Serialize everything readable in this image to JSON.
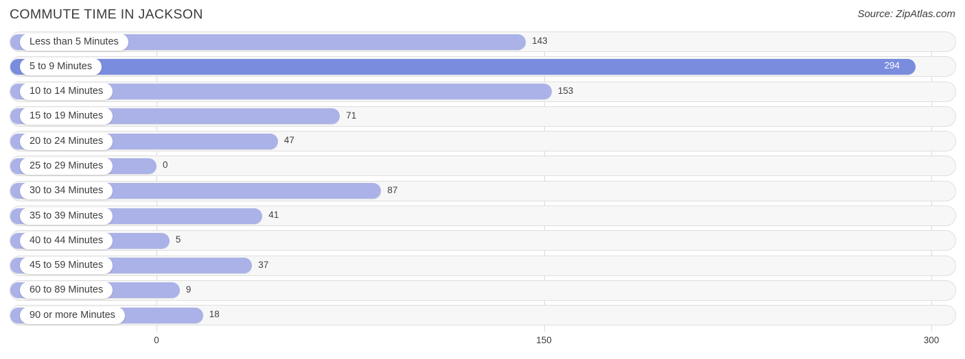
{
  "header": {
    "title": "COMMUTE TIME IN JACKSON",
    "source": "Source: ZipAtlas.com"
  },
  "colors": {
    "bar": "#aab2e8",
    "bar_max": "#7a8cdd",
    "track": "#f7f7f7",
    "track_border": "#dededf",
    "gridline": "#d9d9d9",
    "text": "#3c3c3c"
  },
  "chart_data": {
    "type": "bar",
    "orientation": "horizontal",
    "title": "COMMUTE TIME IN JACKSON",
    "xlabel": "",
    "ylabel": "",
    "xlim": [
      0,
      300
    ],
    "grid": true,
    "legend": false,
    "source": "Source: ZipAtlas.com",
    "xticks": [
      "0",
      "150",
      "300"
    ],
    "xtick_values": [
      0,
      150,
      300
    ],
    "categories": [
      "Less than 5 Minutes",
      "5 to 9 Minutes",
      "10 to 14 Minutes",
      "15 to 19 Minutes",
      "20 to 24 Minutes",
      "25 to 29 Minutes",
      "30 to 34 Minutes",
      "35 to 39 Minutes",
      "40 to 44 Minutes",
      "45 to 59 Minutes",
      "60 to 89 Minutes",
      "90 or more Minutes"
    ],
    "values": [
      143,
      294,
      153,
      71,
      47,
      0,
      87,
      41,
      5,
      37,
      9,
      18
    ],
    "value_labels": [
      "143",
      "294",
      "153",
      "71",
      "47",
      "0",
      "87",
      "41",
      "5",
      "37",
      "9",
      "18"
    ],
    "highlight_index": 1
  },
  "rows": [
    {
      "label": "Less than 5 Minutes",
      "value": 143,
      "value_label": "143",
      "inside": false
    },
    {
      "label": "5 to 9 Minutes",
      "value": 294,
      "value_label": "294",
      "inside": true
    },
    {
      "label": "10 to 14 Minutes",
      "value": 153,
      "value_label": "153",
      "inside": false
    },
    {
      "label": "15 to 19 Minutes",
      "value": 71,
      "value_label": "71",
      "inside": false
    },
    {
      "label": "20 to 24 Minutes",
      "value": 47,
      "value_label": "47",
      "inside": false
    },
    {
      "label": "25 to 29 Minutes",
      "value": 0,
      "value_label": "0",
      "inside": false
    },
    {
      "label": "30 to 34 Minutes",
      "value": 87,
      "value_label": "87",
      "inside": false
    },
    {
      "label": "35 to 39 Minutes",
      "value": 41,
      "value_label": "41",
      "inside": false
    },
    {
      "label": "40 to 44 Minutes",
      "value": 5,
      "value_label": "5",
      "inside": false
    },
    {
      "label": "45 to 59 Minutes",
      "value": 37,
      "value_label": "37",
      "inside": false
    },
    {
      "label": "60 to 89 Minutes",
      "value": 9,
      "value_label": "9",
      "inside": false
    },
    {
      "label": "90 or more Minutes",
      "value": 18,
      "value_label": "18",
      "inside": false
    }
  ],
  "axis": {
    "ticks": [
      {
        "label": "0",
        "value": 0
      },
      {
        "label": "150",
        "value": 150
      },
      {
        "label": "300",
        "value": 300
      }
    ]
  }
}
